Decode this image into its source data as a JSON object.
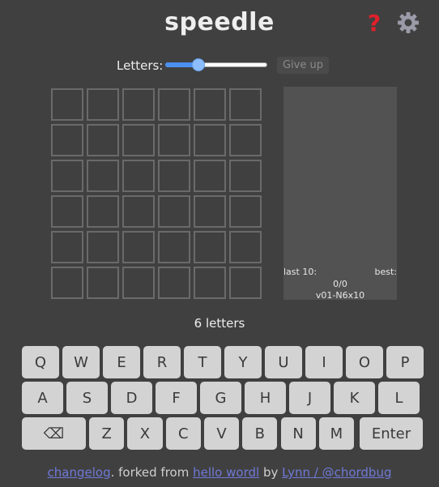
{
  "header": {
    "title": "speedle",
    "help_icon": "question-mark-icon",
    "settings_icon": "gear-icon",
    "help_color": "#e0202a",
    "settings_color": "#9a9aa8"
  },
  "controls": {
    "letters_label": "Letters:",
    "letters_slider_value": 0.3,
    "give_up_label": "Give up"
  },
  "board": {
    "rows": 6,
    "cols": 6
  },
  "stats": {
    "last_label": "last 10:",
    "best_label": "best:",
    "score": "0/0",
    "version": "v01-N6x10"
  },
  "letters_count": "6 letters",
  "keyboard": {
    "row1": [
      "Q",
      "W",
      "E",
      "R",
      "T",
      "Y",
      "U",
      "I",
      "O",
      "P"
    ],
    "row2": [
      "A",
      "S",
      "D",
      "F",
      "G",
      "H",
      "J",
      "K",
      "L"
    ],
    "row3": [
      "⌫",
      "Z",
      "X",
      "C",
      "V",
      "B",
      "N",
      "M",
      "Enter"
    ]
  },
  "footer": {
    "changelog": "changelog",
    "text1": ". forked from ",
    "hello_wordl": "hello wordl",
    "text2": " by ",
    "author": "Lynn / @chordbug"
  }
}
